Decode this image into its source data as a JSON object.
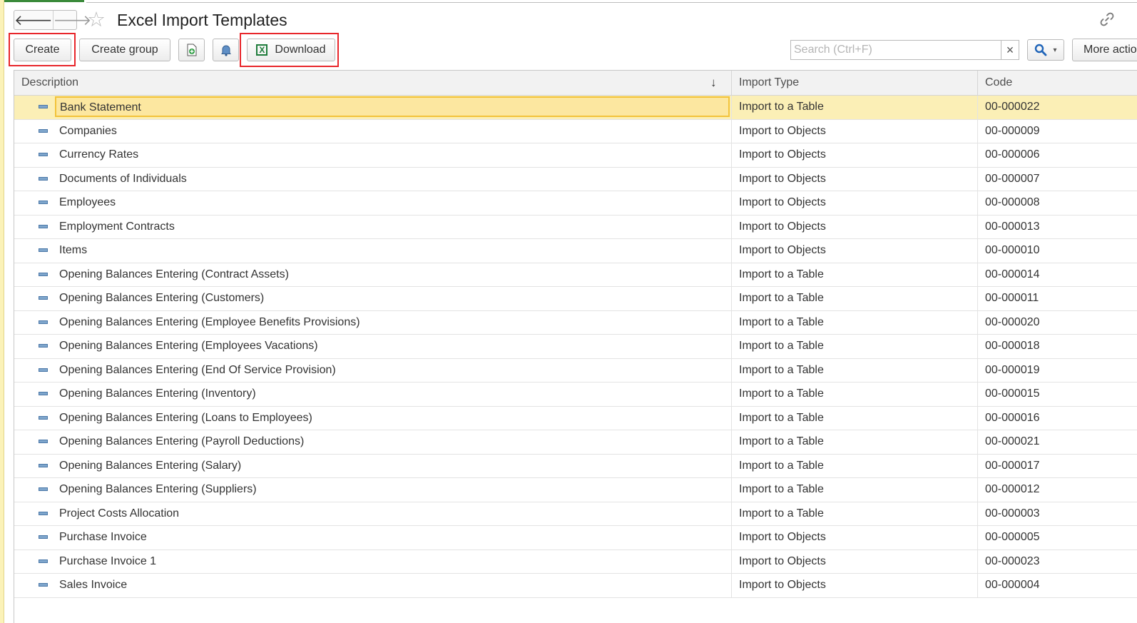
{
  "window": {
    "title": "Excel Import Templates"
  },
  "nav": {
    "back_icon": "arrow-left-icon",
    "forward_icon": "arrow-right-icon",
    "favorite_icon": "star-icon",
    "link_icon": "link-icon"
  },
  "toolbar": {
    "create_label": "Create",
    "create_group_label": "Create group",
    "add_file_icon": "document-add-icon",
    "notify_icon": "bell-icon",
    "download_label": "Download",
    "download_icon": "excel-icon",
    "search_placeholder": "Search (Ctrl+F)",
    "search_clear_glyph": "×",
    "search_icon": "magnifier-icon",
    "more_label": "More actions"
  },
  "colors": {
    "selected_row": "#fbefb6",
    "selected_cell_border": "#f2c33b",
    "highlight_box": "#e8262b",
    "search_accent": "#1f64b8"
  },
  "table": {
    "columns": [
      {
        "label": "Description",
        "sort": "descending-arrow"
      },
      {
        "label": "Import Type"
      },
      {
        "label": "Code"
      }
    ],
    "rows": [
      {
        "description": "Bank Statement",
        "import_type": "Import to a Table",
        "code": "00-000022",
        "selected": true
      },
      {
        "description": "Companies",
        "import_type": "Import to Objects",
        "code": "00-000009"
      },
      {
        "description": "Currency Rates",
        "import_type": "Import to Objects",
        "code": "00-000006"
      },
      {
        "description": "Documents of Individuals",
        "import_type": "Import to Objects",
        "code": "00-000007"
      },
      {
        "description": "Employees",
        "import_type": "Import to Objects",
        "code": "00-000008"
      },
      {
        "description": "Employment Contracts",
        "import_type": "Import to Objects",
        "code": "00-000013"
      },
      {
        "description": "Items",
        "import_type": "Import to Objects",
        "code": "00-000010"
      },
      {
        "description": "Opening Balances Entering (Contract Assets)",
        "import_type": "Import to a Table",
        "code": "00-000014"
      },
      {
        "description": "Opening Balances Entering (Customers)",
        "import_type": "Import to a Table",
        "code": "00-000011"
      },
      {
        "description": "Opening Balances Entering (Employee Benefits Provisions)",
        "import_type": "Import to a Table",
        "code": "00-000020"
      },
      {
        "description": "Opening Balances Entering (Employees Vacations)",
        "import_type": "Import to a Table",
        "code": "00-000018"
      },
      {
        "description": "Opening Balances Entering (End Of Service Provision)",
        "import_type": "Import to a Table",
        "code": "00-000019"
      },
      {
        "description": "Opening Balances Entering (Inventory)",
        "import_type": "Import to a Table",
        "code": "00-000015"
      },
      {
        "description": "Opening Balances Entering (Loans to Employees)",
        "import_type": "Import to a Table",
        "code": "00-000016"
      },
      {
        "description": "Opening Balances Entering (Payroll Deductions)",
        "import_type": "Import to a Table",
        "code": "00-000021"
      },
      {
        "description": "Opening Balances Entering (Salary)",
        "import_type": "Import to a Table",
        "code": "00-000017"
      },
      {
        "description": "Opening Balances Entering (Suppliers)",
        "import_type": "Import to a Table",
        "code": "00-000012"
      },
      {
        "description": "Project Costs Allocation",
        "import_type": "Import to a Table",
        "code": "00-000003"
      },
      {
        "description": "Purchase Invoice",
        "import_type": "Import to Objects",
        "code": "00-000005"
      },
      {
        "description": "Purchase Invoice 1",
        "import_type": "Import to Objects",
        "code": "00-000023"
      },
      {
        "description": "Sales Invoice",
        "import_type": "Import to Objects",
        "code": "00-000004"
      }
    ]
  }
}
